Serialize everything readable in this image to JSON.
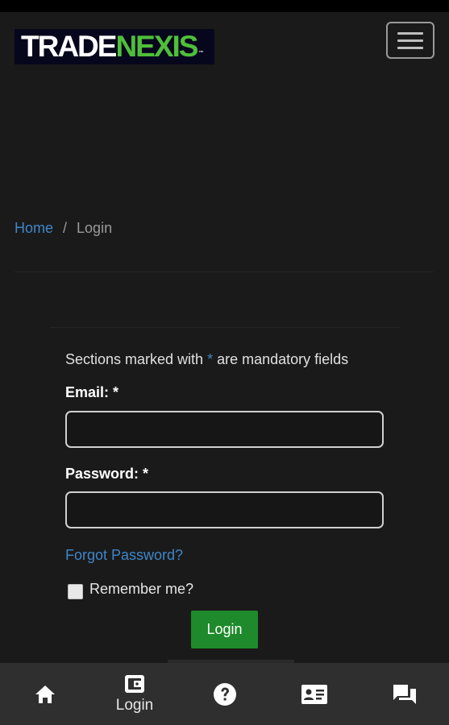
{
  "header": {
    "logo": {
      "part1": "TRADE",
      "part2": "NEXIS",
      "mark": "™"
    },
    "menu_icon": "hamburger-icon"
  },
  "breadcrumb": {
    "home": "Home",
    "separator": "/",
    "current": "Login"
  },
  "form": {
    "note_before": "Sections marked with ",
    "note_star": "*",
    "note_after": " are mandatory fields",
    "email_label": "Email: *",
    "email_value": "",
    "password_label": "Password: *",
    "password_value": "",
    "forgot_link": "Forgot Password?",
    "remember_label": "Remember me?",
    "remember_checked": false,
    "submit_label": "Login"
  },
  "bottom_nav": {
    "items": [
      {
        "icon": "home-icon",
        "label": ""
      },
      {
        "icon": "wallet-icon",
        "label": "Login"
      },
      {
        "icon": "help-icon",
        "label": ""
      },
      {
        "icon": "contact-card-icon",
        "label": ""
      },
      {
        "icon": "chat-icon",
        "label": ""
      }
    ]
  },
  "colors": {
    "background": "#1a1a1a",
    "link": "#3f86c9",
    "brand_green": "#4fbf3a",
    "button": "#1e8a2b",
    "nav_bar": "#2f2f2f"
  }
}
